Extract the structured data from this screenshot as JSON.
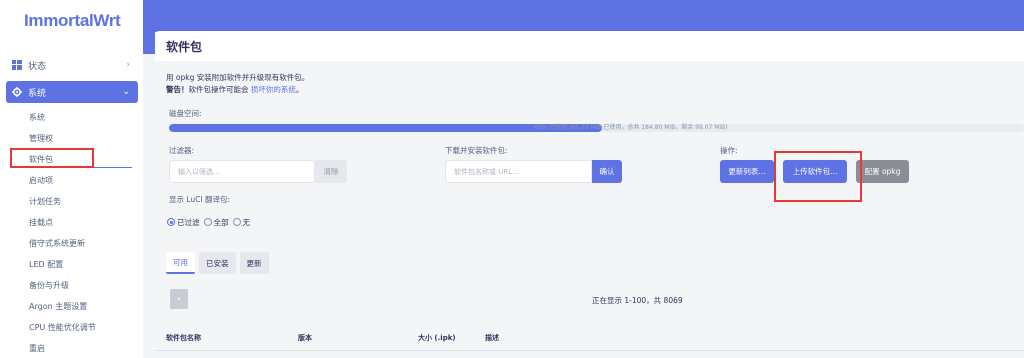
{
  "brand": "ImmortalWrt",
  "sidebar": {
    "status_label": "状态",
    "system_label": "系统",
    "sub_items": [
      "系统",
      "管理权",
      "软件包",
      "启动项",
      "计划任务",
      "挂载点",
      "借守式系统更新",
      "LED 配置",
      "备份与升级",
      "Argon 主题设置",
      "CPU 性能优化调节",
      "重启"
    ]
  },
  "page": {
    "title": "软件包",
    "desc_line1": "用 opkg 安装附加软件并升级现有软件包。",
    "desc_warn": "警告！",
    "desc_line2": "软件包操作可能会",
    "desc_link": "损坏你的系统",
    "desc_end": "。"
  },
  "disk": {
    "label": "磁盘空间:",
    "used_fraction": 0.507,
    "text": "46% 已使用 (85.73 MiB 已使用，总共 184.80 MiB，剩余 99.07 MiB)"
  },
  "filter": {
    "label": "过滤器:",
    "placeholder": "输入以筛选...",
    "clear_label": "清除"
  },
  "download": {
    "label": "下载并安装软件包:",
    "placeholder": "软件包名称或 URL...",
    "ok_label": "确认"
  },
  "actions": {
    "label": "操作:",
    "update_label": "更新列表...",
    "upload_label": "上传软件包...",
    "config_label": "配置 opkg"
  },
  "luci": {
    "label": "显示 LuCI 翻译包:",
    "options": [
      "已过滤",
      "全部",
      "无"
    ],
    "selected": "已过滤"
  },
  "tabs": [
    "可用",
    "已安装",
    "更新"
  ],
  "pager": {
    "prev": "«",
    "text": "正在显示 1-100，共 8069"
  },
  "table": {
    "headers": [
      "软件包名称",
      "版本",
      "大小 (.ipk)",
      "描述"
    ]
  }
}
